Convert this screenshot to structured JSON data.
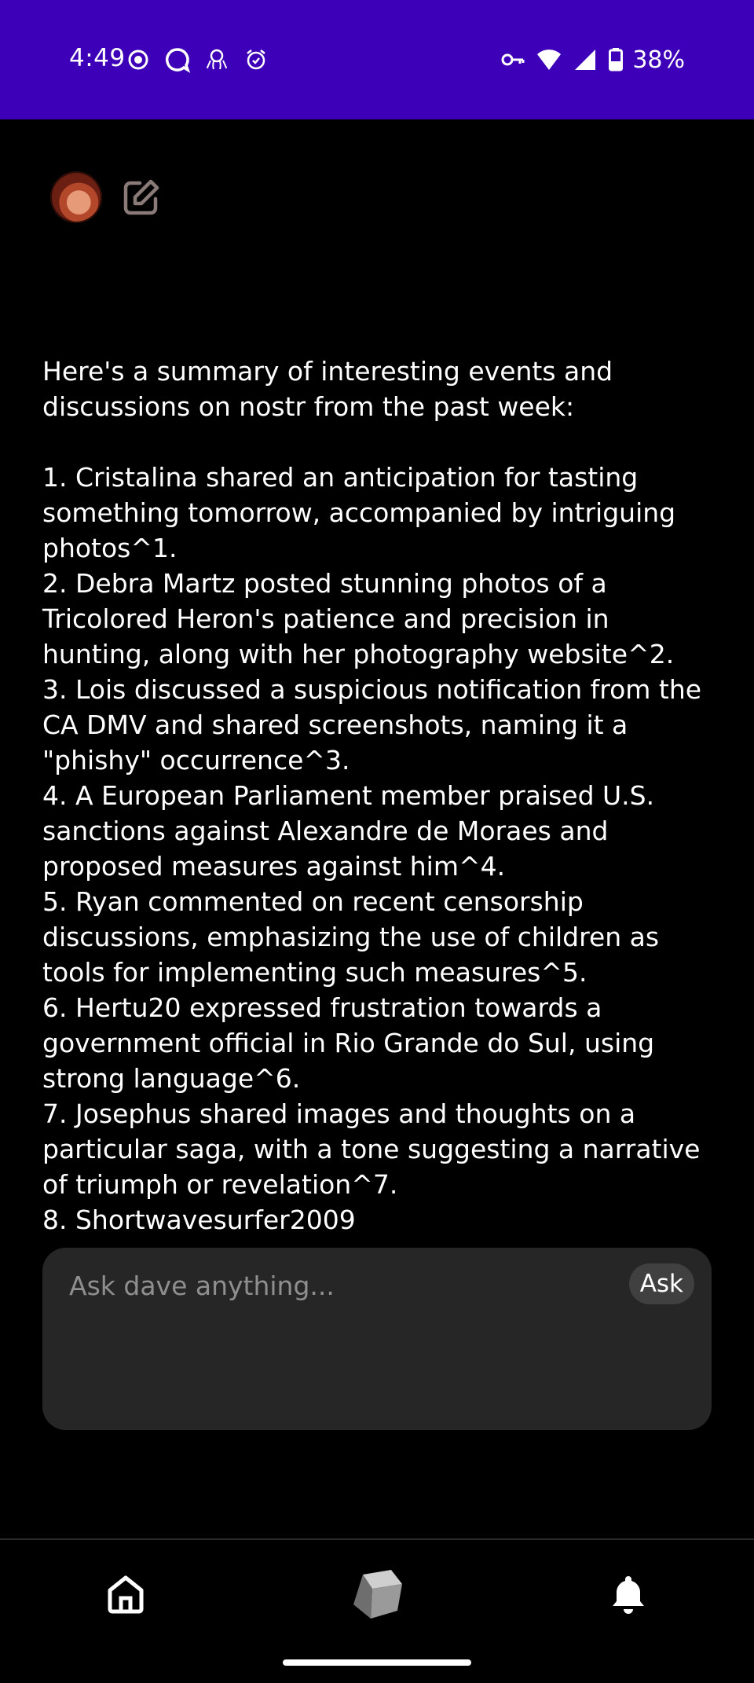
{
  "status_bar": {
    "time": "4:49",
    "battery": "38%",
    "left_icons": [
      "sync-icon",
      "chat-bubble-icon",
      "octopus-icon",
      "alarm-icon"
    ],
    "right_icons": [
      "vpn-key-icon",
      "wifi-icon",
      "cell-signal-icon",
      "battery-icon"
    ],
    "background": "#3d00b8"
  },
  "header": {
    "avatar": "user-avatar",
    "compose_icon": "edit-icon"
  },
  "response": {
    "text": "Here's a summary of interesting events and discussions on nostr from the past week:\n\n1. Cristalina shared an anticipation for tasting something tomorrow, accompanied by intriguing photos^1.\n2. Debra Martz posted stunning photos of a Tricolored Heron's patience and precision in hunting, along with her photography website^2.\n3. Lois discussed a suspicious notification from the CA DMV and shared screenshots, naming it a \"phishy\" occurrence^3.\n4. A European Parliament member praised U.S. sanctions against Alexandre de Moraes and proposed measures against him^4.\n5. Ryan commented on recent censorship discussions, emphasizing the use of children as tools for implementing such measures^5.\n6. Hertu20 expressed frustration towards a government official in Rio Grande do Sul, using strong language^6.\n7. Josephus shared images and thoughts on a particular saga, with a tone suggesting a narrative of triumph or revelation^7.\n8. Shortwavesurfer2009"
  },
  "ask": {
    "placeholder": "Ask dave anything...",
    "value": "",
    "button_label": "Ask"
  },
  "bottom_nav": {
    "items": [
      "home-icon",
      "cube-icon",
      "bell-icon"
    ]
  }
}
